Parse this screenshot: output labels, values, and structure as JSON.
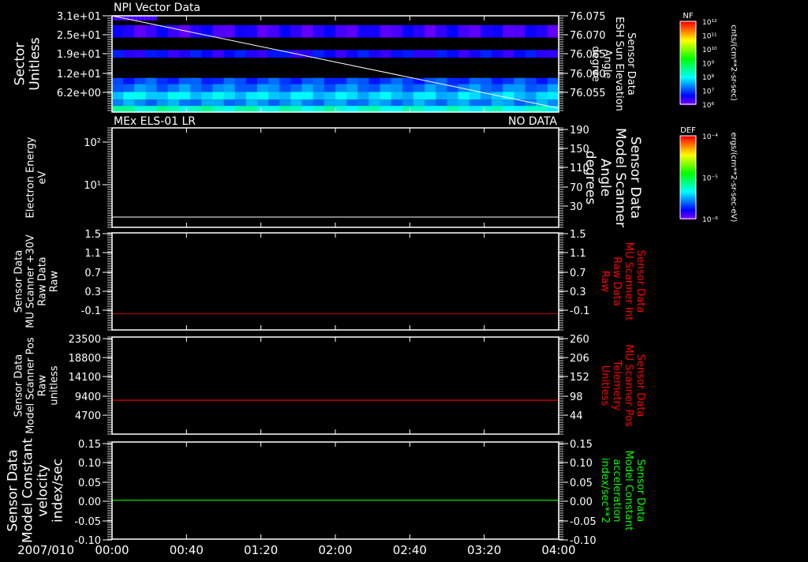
{
  "chart_data": [
    {
      "type": "heatmap",
      "title": "NPI Vector Data",
      "ylabel": [
        "Sector",
        "Unitless"
      ],
      "yticks": [
        "3.1e+01",
        "2.5e+01",
        "1.9e+01",
        "1.2e+01",
        "6.2e+00"
      ],
      "ylim": [
        0,
        31
      ],
      "right_ylabel": [
        "Sensor Data",
        "ESH Sun Elevation",
        "Angle",
        "degree"
      ],
      "right_yticks": [
        "76.075",
        "76.070",
        "76.065",
        "76.060",
        "76.055"
      ],
      "right_ylim": [
        76.05,
        76.075
      ],
      "bands": [
        {
          "sectors": [
            29.5,
            31
          ],
          "log_flux": 6.3,
          "extent": 0.1
        },
        {
          "sectors": [
            24,
            28
          ],
          "log_flux": 6.4,
          "extent": 1.0
        },
        {
          "sectors": [
            17.5,
            20
          ],
          "log_flux": 6.6,
          "extent": 1.0
        },
        {
          "sectors": [
            9,
            11
          ],
          "log_flux": 7.0,
          "extent": 1.0
        },
        {
          "sectors": [
            6.5,
            9
          ],
          "log_flux": 7.3,
          "extent": 1.0
        },
        {
          "sectors": [
            4,
            6.5
          ],
          "log_flux": 7.9,
          "extent": 1.0
        },
        {
          "sectors": [
            2,
            4
          ],
          "log_flux": 7.4,
          "extent": 1.0
        },
        {
          "sectors": [
            0,
            2
          ],
          "log_flux": 8.4,
          "extent": 1.0
        }
      ],
      "line_series": {
        "x": [
          "00:00",
          "04:00"
        ],
        "y": [
          76.075,
          76.051
        ],
        "color": "#ffffff"
      },
      "colorbar": {
        "label": "NF",
        "unit": "cnts/(cm**2-sr-sec)",
        "ticks": [
          "10¹²",
          "10¹¹",
          "10¹⁰",
          "10⁹",
          "10⁸",
          "10⁷",
          "10⁶"
        ]
      }
    },
    {
      "type": "line",
      "title": "MEx ELS-01 LR",
      "status": "NO DATA",
      "ylabel": [
        "Electron Energy",
        "eV"
      ],
      "yticks": [
        "10²",
        "10¹"
      ],
      "yscale": "log",
      "right_ylabel": [
        "Sensor Data",
        "Model Scanner",
        "Angle",
        "degrees"
      ],
      "right_yticks": [
        "190",
        "150",
        "110",
        "70",
        "30"
      ],
      "right_ylim": [
        -10,
        200
      ],
      "series": [
        {
          "y": 7,
          "color": "#ffffff"
        }
      ],
      "colorbar": {
        "label": "DEF",
        "unit": "ergs/(cm**2-sr-sec-eV)",
        "ticks": [
          "10⁻⁴",
          "10⁻⁵",
          "10⁻⁶"
        ]
      }
    },
    {
      "type": "line",
      "ylabel": [
        "Sensor Data",
        "MU Scanner +30V",
        "Raw Data",
        "Raw"
      ],
      "yticks": [
        "1.5",
        "1.1",
        "0.7",
        "0.3",
        "-0.1"
      ],
      "ylim": [
        -0.3,
        1.5
      ],
      "right_ylabel": [
        "Sensor Data",
        "MU Scanner Int",
        "Raw Data",
        "Raw"
      ],
      "right_yticks": [
        "1.5",
        "1.1",
        "0.7",
        "0.3",
        "-0.1"
      ],
      "series": [
        {
          "y": 0.0,
          "color": "#b00000"
        }
      ],
      "right_label_color": "#ff0000"
    },
    {
      "type": "line",
      "ylabel": [
        "Sensor Data",
        "Model Scanner Pos",
        "Raw",
        "unitless"
      ],
      "yticks": [
        "23500",
        "18800",
        "14100",
        "9400",
        "4700"
      ],
      "ylim": [
        0,
        23500
      ],
      "right_ylabel": [
        "Sensor Data",
        "MU Scanner Pos",
        "Telemetry",
        "Unitless"
      ],
      "right_yticks": [
        "260",
        "206",
        "152",
        "98",
        "44"
      ],
      "series": [
        {
          "y": 8200,
          "color": "#ff0000"
        }
      ],
      "right_label_color": "#ff0000"
    },
    {
      "type": "line",
      "ylabel": [
        "Sensor Data",
        "Model Constant",
        "velocity",
        "index/sec"
      ],
      "yticks": [
        "0.15",
        "0.10",
        "0.05",
        "0.00",
        "-0.05",
        "-0.10"
      ],
      "ylim": [
        -0.1,
        0.15
      ],
      "right_ylabel": [
        "Sensor Data",
        "Model Constant",
        "acceleration",
        "index/sec**2"
      ],
      "right_yticks": [
        "0.15",
        "0.10",
        "0.05",
        "0.00",
        "-0.05",
        "-0.10"
      ],
      "series": [
        {
          "y": 0.0,
          "color": "#00ff00"
        }
      ],
      "right_label_color": "#00ff00"
    }
  ],
  "x_axis": {
    "date": "2007/010",
    "ticks": [
      "00:00",
      "00:40",
      "01:20",
      "02:00",
      "02:40",
      "03:20",
      "04:00"
    ]
  }
}
